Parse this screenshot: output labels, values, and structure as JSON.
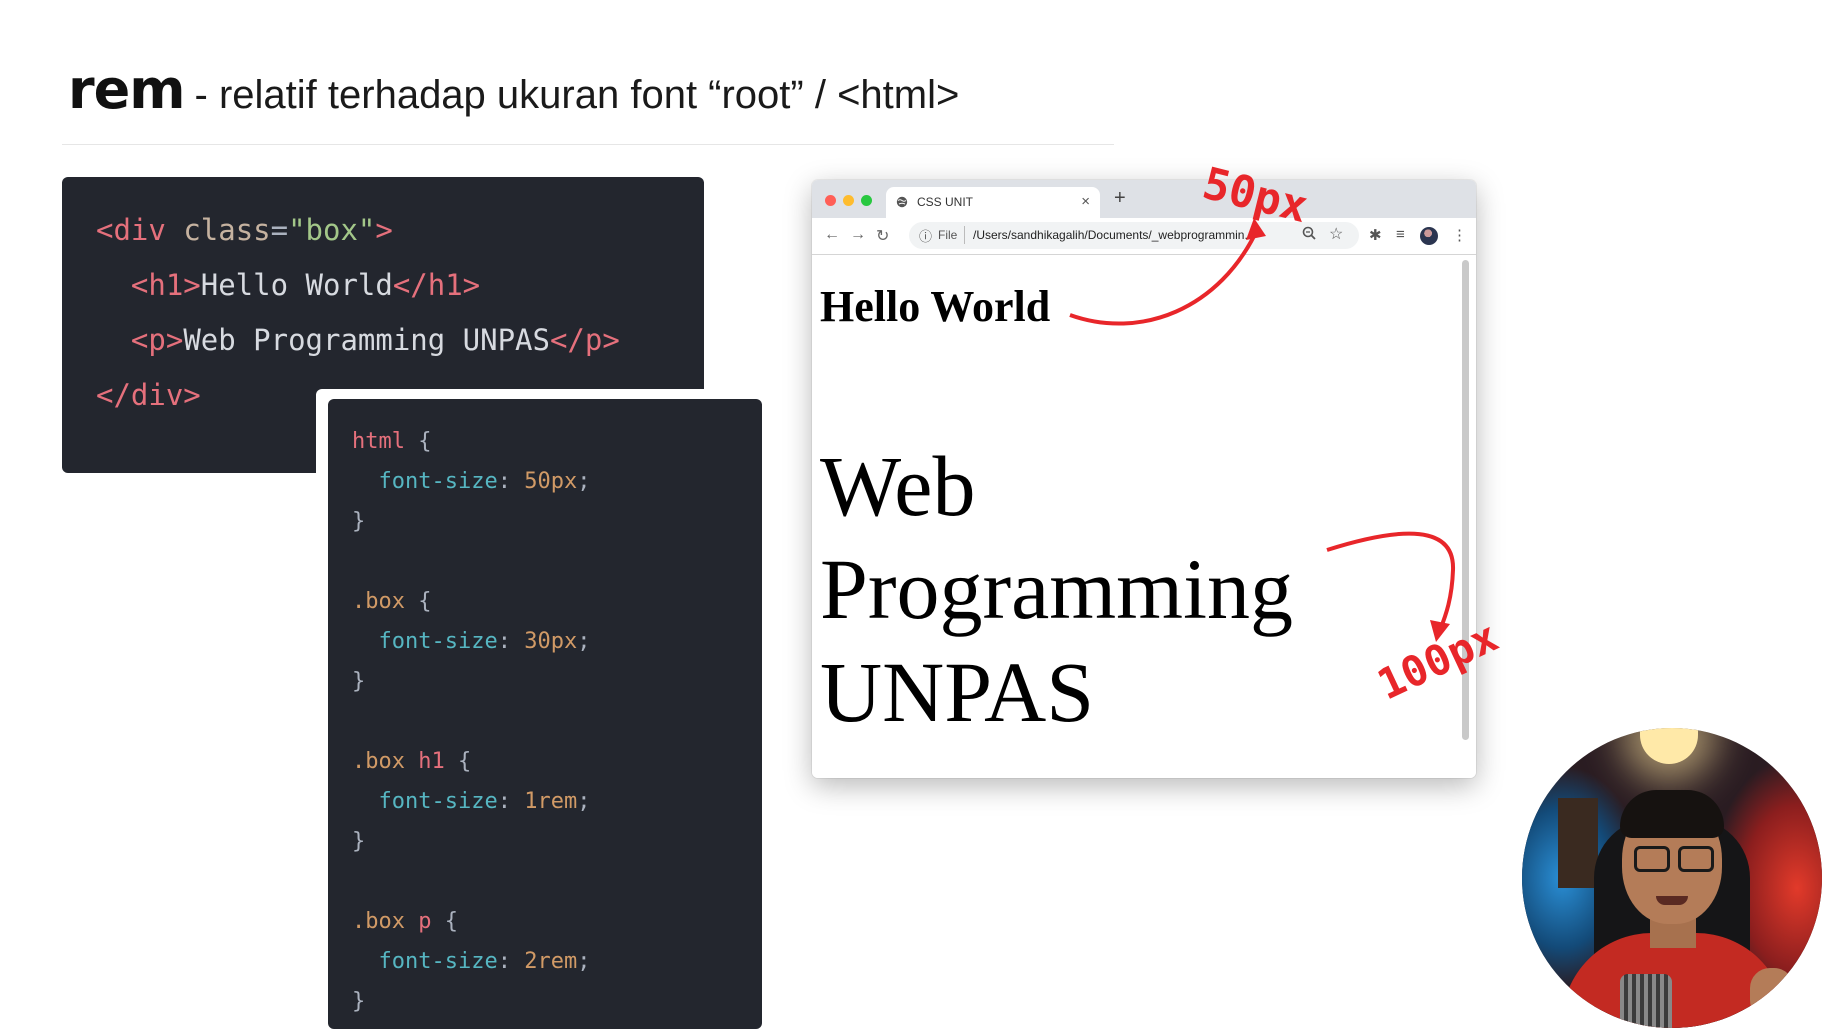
{
  "slide": {
    "keyword": "rem",
    "description": "- relatif terhadap ukuran font “root” / <html>"
  },
  "html_code": {
    "lines": [
      [
        {
          "t": "tag",
          "v": "<div "
        },
        {
          "t": "attr",
          "v": "class"
        },
        {
          "t": "punc",
          "v": "="
        },
        {
          "t": "str",
          "v": "\"box\""
        },
        {
          "t": "tag",
          "v": ">"
        }
      ],
      [
        {
          "t": "text",
          "v": "  "
        },
        {
          "t": "tag",
          "v": "<h1>"
        },
        {
          "t": "text",
          "v": "Hello World"
        },
        {
          "t": "tag",
          "v": "</h1>"
        }
      ],
      [
        {
          "t": "text",
          "v": "  "
        },
        {
          "t": "tag",
          "v": "<p>"
        },
        {
          "t": "text",
          "v": "Web Programming UNPAS"
        },
        {
          "t": "tag",
          "v": "</p>"
        }
      ],
      [
        {
          "t": "tag",
          "v": "</div>"
        }
      ]
    ]
  },
  "css_code": {
    "lines": [
      [
        {
          "t": "sel",
          "v": "html "
        },
        {
          "t": "punc",
          "v": "{"
        }
      ],
      [
        {
          "t": "text",
          "v": "  "
        },
        {
          "t": "prop",
          "v": "font-size"
        },
        {
          "t": "punc",
          "v": ": "
        },
        {
          "t": "val",
          "v": "50px"
        },
        {
          "t": "punc",
          "v": ";"
        }
      ],
      [
        {
          "t": "punc",
          "v": "}"
        }
      ],
      [],
      [
        {
          "t": "cls",
          "v": ".box "
        },
        {
          "t": "punc",
          "v": "{"
        }
      ],
      [
        {
          "t": "text",
          "v": "  "
        },
        {
          "t": "prop",
          "v": "font-size"
        },
        {
          "t": "punc",
          "v": ": "
        },
        {
          "t": "val",
          "v": "30px"
        },
        {
          "t": "punc",
          "v": ";"
        }
      ],
      [
        {
          "t": "punc",
          "v": "}"
        }
      ],
      [],
      [
        {
          "t": "cls",
          "v": ".box "
        },
        {
          "t": "sel",
          "v": "h1 "
        },
        {
          "t": "punc",
          "v": "{"
        }
      ],
      [
        {
          "t": "text",
          "v": "  "
        },
        {
          "t": "prop",
          "v": "font-size"
        },
        {
          "t": "punc",
          "v": ": "
        },
        {
          "t": "val",
          "v": "1rem"
        },
        {
          "t": "punc",
          "v": ";"
        }
      ],
      [
        {
          "t": "punc",
          "v": "}"
        }
      ],
      [],
      [
        {
          "t": "cls",
          "v": ".box "
        },
        {
          "t": "sel",
          "v": "p "
        },
        {
          "t": "punc",
          "v": "{"
        }
      ],
      [
        {
          "t": "text",
          "v": "  "
        },
        {
          "t": "prop",
          "v": "font-size"
        },
        {
          "t": "punc",
          "v": ": "
        },
        {
          "t": "val",
          "v": "2rem"
        },
        {
          "t": "punc",
          "v": ";"
        }
      ],
      [
        {
          "t": "punc",
          "v": "}"
        }
      ]
    ]
  },
  "browser": {
    "tab_title": "CSS UNIT",
    "tab_close": "×",
    "new_tab": "+",
    "back": "←",
    "forward": "→",
    "reload": "↻",
    "info_icon": "ⓘ",
    "scheme": "File",
    "url": "/Users/sandhikagalih/Documents/_webprogrammin...",
    "star": "☆",
    "extensions": "✱",
    "media": "≡",
    "menu": "⋮",
    "page": {
      "h1": "Hello World",
      "p": "Web Programming UNPAS"
    }
  },
  "annotations": {
    "h1_size": "50px",
    "p_size": "100px",
    "color": "#e8262a"
  }
}
